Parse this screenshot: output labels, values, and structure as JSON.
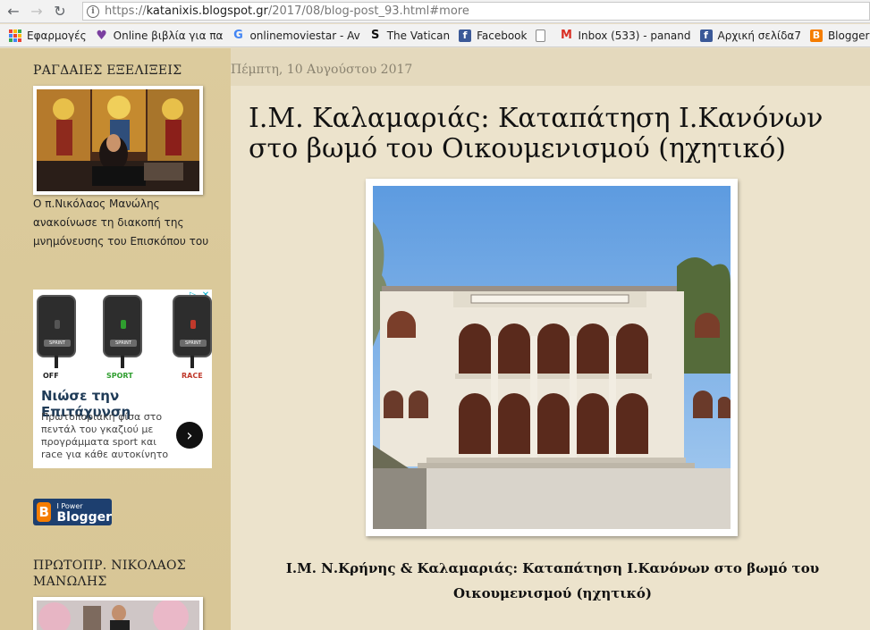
{
  "browser": {
    "url_scheme": "https://",
    "url_host": "katanixis.blogspot.gr",
    "url_path": "/2017/08/blog-post_93.html#more"
  },
  "bookmarks": [
    {
      "label": "Εφαρμογές",
      "icon": "apps-grid-icon"
    },
    {
      "label": "Online βιβλία για πα",
      "icon": "heart-icon"
    },
    {
      "label": "onlinemoviestar - Av",
      "icon": "google-icon"
    },
    {
      "label": "The Vatican",
      "icon": "s-icon"
    },
    {
      "label": "Facebook",
      "icon": "facebook-icon"
    },
    {
      "label": "",
      "icon": "page-icon"
    },
    {
      "label": "Inbox (533) - panand",
      "icon": "gmail-icon"
    },
    {
      "label": "Αρχική σελίδα7",
      "icon": "facebook-icon"
    },
    {
      "label": "Blogger: Ιδ",
      "icon": "blogger-icon"
    }
  ],
  "sidebar": {
    "widget1_title": "ΡΑΓΔΑΙΕΣ ΕΞΕΛΙΞΕΙΣ",
    "widget1_caption": "Ο π.Νικόλαος Μανώλης ανακοίνωσε τη διακοπή της μνημόνευσης του Επισκόπου του",
    "ad": {
      "labels": [
        "OFF",
        "SPORT",
        "RACE"
      ],
      "headline": "Νιώσε την Επιτάχυνση",
      "body": "Πρωτοποριακή φίσα στο πεντάλ του γκαζιού με προγράμματα sport και race για κάθε αυτοκίνητο",
      "pedal_logo": "SPRINT"
    },
    "blogger_badge": {
      "small": "I Power",
      "big": "Blogger"
    },
    "widget2_title": "ΠΡΩΤΟΠΡ. ΝΙΚΟΛΑΟΣ ΜΑΝΩΛΗΣ"
  },
  "post": {
    "date": "Πέμπτη, 10 Αυγούστου 2017",
    "title": "Ι.Μ. Καλαμαριάς: Καταπάτηση Ι.Κανόνων στο βωμό του Οικουμενισμού (ηχητικό)",
    "subtitle": "Ι.Μ. Ν.Κρήνης & Καλαμαριάς: Καταπάτηση Ι.Κανόνων στο βωμό του Οικουμενισμού (ηχητικό)"
  },
  "colors": {
    "sidebar_bg": "#dccb9d",
    "post_bg": "#ece3cc",
    "date_text": "#8a8370",
    "ad_headline": "#1f3b57",
    "sport_green": "#2f9e2f",
    "race_red": "#c0392b"
  }
}
